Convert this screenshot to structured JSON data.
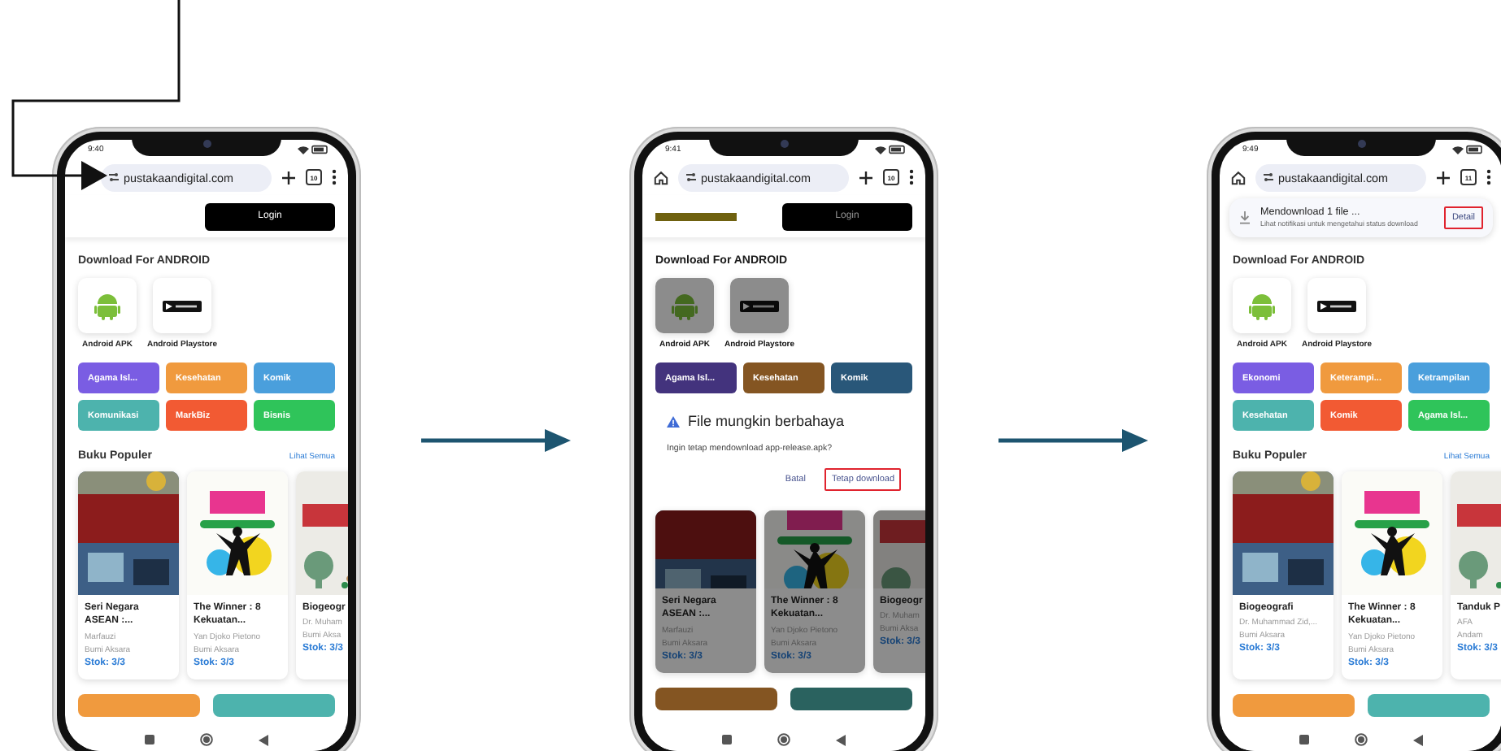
{
  "phones": [
    {
      "time": "9:40",
      "home_button": false,
      "url": "pustakaandigital.com",
      "tab_count": "10",
      "dimmed": false,
      "header": {
        "logo": false,
        "login": "Login"
      },
      "download_title": "Download For ANDROID",
      "downloads": [
        {
          "kind": "apk",
          "label": "Android APK"
        },
        {
          "kind": "playstore",
          "label": "Android Playstore"
        }
      ],
      "categories": [
        {
          "label": "Agama Isl...",
          "color": "#7a5de3"
        },
        {
          "label": "Kesehatan",
          "color": "#f09a3e"
        },
        {
          "label": "Komik",
          "color": "#4a9fdc"
        },
        {
          "label": "Komunikasi",
          "color": "#4db3ad"
        },
        {
          "label": "MarkBiz",
          "color": "#f25a33"
        },
        {
          "label": "Bisnis",
          "color": "#2fc45a"
        }
      ],
      "popular": {
        "title": "Buku Populer",
        "see_all": "Lihat Semua"
      },
      "books": [
        {
          "title": "Seri Negara ASEAN :...",
          "author": "Marfauzi",
          "publisher": "Bumi Aksara",
          "stock": "Stok: 3/3"
        },
        {
          "title": "The Winner : 8 Kekuatan...",
          "author": "Yan Djoko Pietono",
          "publisher": "Bumi Aksara",
          "stock": "Stok: 3/3"
        },
        {
          "title": "Biogeogr",
          "author": "Dr. Muham",
          "publisher": "Bumi Aksa",
          "stock": "Stok: 3/3"
        }
      ],
      "bottom_buttons": [
        {
          "color": "#f09a3e"
        },
        {
          "color": "#4db3ad"
        }
      ]
    },
    {
      "time": "9:41",
      "home_button": true,
      "url": "pustakaandigital.com",
      "tab_count": "10",
      "dimmed": true,
      "header": {
        "logo": true,
        "login": "Login"
      },
      "download_title": "Download For ANDROID",
      "downloads": [
        {
          "kind": "apk",
          "label": "Android APK"
        },
        {
          "kind": "playstore",
          "label": "Android Playstore"
        }
      ],
      "categories": [
        {
          "label": "Agama Isl...",
          "color": "#43337d"
        },
        {
          "label": "Kesehatan",
          "color": "#845522"
        },
        {
          "label": "Komik",
          "color": "#295779"
        }
      ],
      "dialog": {
        "title": "File mungkin berbahaya",
        "message": "Ingin tetap mendownload app-release.apk?",
        "buttons": [
          {
            "label": "Batal",
            "highlighted": false
          },
          {
            "label": "Tetap download",
            "highlighted": true
          }
        ]
      },
      "books": [
        {
          "title": "Seri Negara ASEAN :...",
          "author": "Marfauzi",
          "publisher": "Bumi Aksara",
          "stock": "Stok: 3/3"
        },
        {
          "title": "The Winner : 8 Kekuatan...",
          "author": "Yan Djoko Pietono",
          "publisher": "Bumi Aksara",
          "stock": "Stok: 3/3"
        },
        {
          "title": "Biogeogr",
          "author": "Dr. Muham",
          "publisher": "Bumi Aksa",
          "stock": "Stok: 3/3"
        }
      ],
      "bottom_buttons": [
        {
          "color": "#845522"
        },
        {
          "color": "#2a625f"
        }
      ]
    },
    {
      "time": "9:49",
      "home_button": true,
      "url": "pustakaandigital.com",
      "tab_count": "11",
      "dimmed": false,
      "download_bubble": {
        "title": "Mendownload 1 file ...",
        "message": "Lihat notifikasi untuk mengetahui status download",
        "button": {
          "label": "Detail",
          "highlighted": true
        }
      },
      "download_title": "Download For ANDROID",
      "downloads": [
        {
          "kind": "apk",
          "label": "Android APK"
        },
        {
          "kind": "playstore",
          "label": "Android Playstore"
        }
      ],
      "categories": [
        {
          "label": "Ekonomi",
          "color": "#7a5de3"
        },
        {
          "label": "Keterampi...",
          "color": "#f09a3e"
        },
        {
          "label": "Ketrampilan",
          "color": "#4a9fdc"
        },
        {
          "label": "Kesehatan",
          "color": "#4db3ad"
        },
        {
          "label": "Komik",
          "color": "#f25a33"
        },
        {
          "label": "Agama Isl...",
          "color": "#2fc45a"
        }
      ],
      "popular": {
        "title": "Buku Populer",
        "see_all": "Lihat Semua"
      },
      "books": [
        {
          "title": "Biogeografi",
          "author": "Dr. Muhammad Zid,...",
          "publisher": "Bumi Aksara",
          "stock": "Stok: 3/3"
        },
        {
          "title": "The Winner : 8 Kekuatan...",
          "author": "Yan Djoko Pietono",
          "publisher": "Bumi Aksara",
          "stock": "Stok: 3/3"
        },
        {
          "title": "Tanduk P",
          "author": "AFA",
          "publisher": "Andam",
          "stock": "Stok: 3/3"
        }
      ],
      "bottom_buttons": [
        {
          "color": "#f09a3e"
        },
        {
          "color": "#4db3ad"
        }
      ]
    }
  ]
}
